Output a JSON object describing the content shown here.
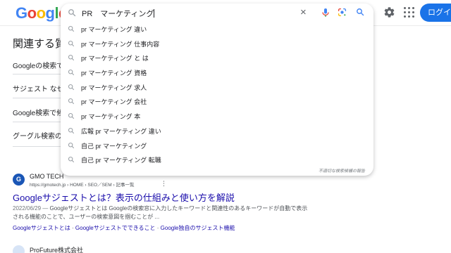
{
  "header": {
    "logo": [
      "G",
      "o",
      "o",
      "g",
      "l",
      "e"
    ],
    "logo_colors": [
      "#4285f4",
      "#ea4335",
      "#fbbc05",
      "#4285f4",
      "#34a853",
      "#ea4335"
    ],
    "login_label": "ログイン"
  },
  "search": {
    "query": "PR　マーケティング",
    "clear_icon": "×"
  },
  "suggestions": [
    "pr マーケティング 違い",
    "pr マーケティング 仕事内容",
    "pr マーケティング と は",
    "pr マーケティング 資格",
    "pr マーケティング 求人",
    "pr マーケティング 会社",
    "pr マーケティング 本",
    "広報 pr マーケティング 違い",
    "自己 pr マーケティング",
    "自己 pr マーケティング 転職"
  ],
  "report_link": "不適切な検索候補の報告",
  "paa": {
    "title": "関連する質",
    "items": [
      "Googleの検索でサ",
      "サジェスト なせ",
      "Google検索で候",
      "グーグル検索の"
    ]
  },
  "result1": {
    "favicon_letter": "G",
    "site_name": "GMO TECH",
    "url": "https://gmotech.jp › HOME › SEO／SEM › 記事一覧",
    "title": "Googleサジェストとは？表示の仕組みと使い方を解説",
    "date": "2022/06/29 —",
    "snippet": " Googleサジェストとは Googleの検索窓に入力したキーワードと関連性のあるキーワードが自動で表示される機能のことで、ユーザーの検索意図を掴むことが ...",
    "links": [
      "Googleサジェストとは",
      "Googleサジェストでできること",
      "Google独自のサジェスト機能"
    ]
  },
  "result2": {
    "site_name": "ProFuture株式会社"
  }
}
